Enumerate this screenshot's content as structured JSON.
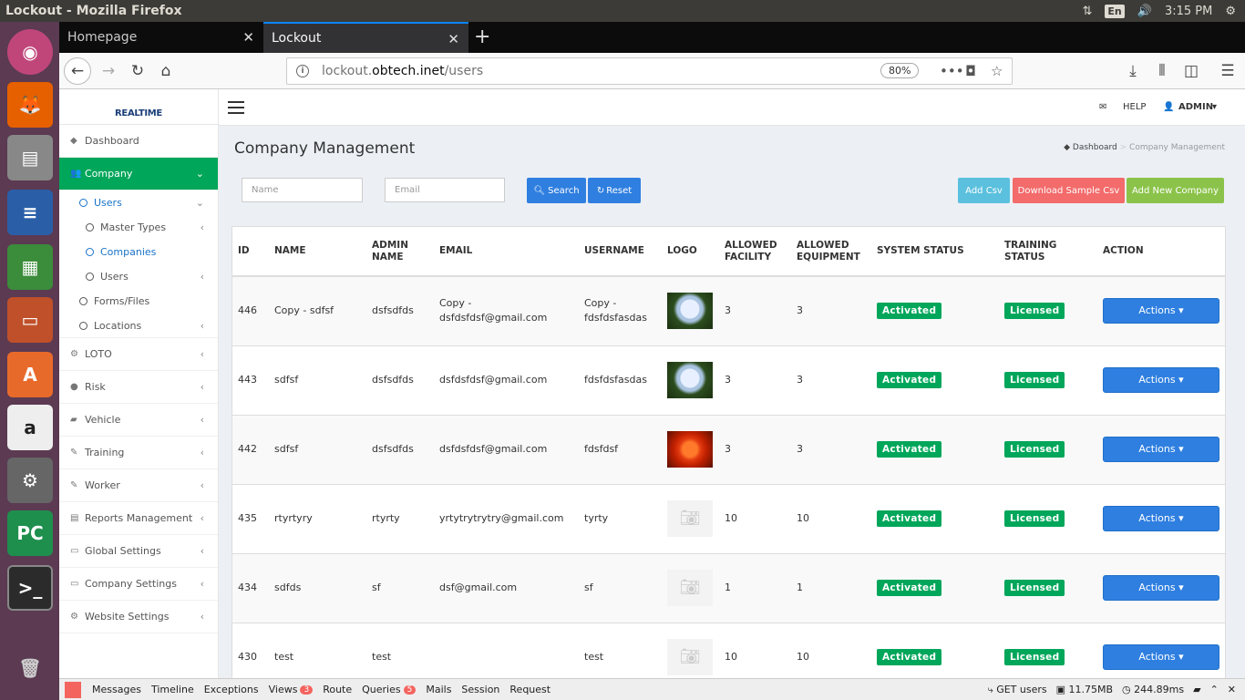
{
  "os": {
    "window_title": "Lockout - Mozilla Firefox",
    "keyboard": "En",
    "clock": "3:15 PM"
  },
  "browser": {
    "tabs": [
      {
        "label": "Homepage"
      },
      {
        "label": "Lockout"
      }
    ],
    "url_host": "lockout.",
    "url_domain": "obtech.inet",
    "url_path": "/users",
    "zoom": "80%"
  },
  "app": {
    "logo": "REALTIME",
    "header": {
      "help": "HELP",
      "user": "ADMIN"
    },
    "sidebar": [
      {
        "label": "Dashboard"
      },
      {
        "label": "Company"
      },
      {
        "label": "Users"
      },
      {
        "label": "Master Types"
      },
      {
        "label": "Companies"
      },
      {
        "label": "Users"
      },
      {
        "label": "Forms/Files"
      },
      {
        "label": "Locations"
      },
      {
        "label": "LOTO"
      },
      {
        "label": "Risk"
      },
      {
        "label": "Vehicle"
      },
      {
        "label": "Training"
      },
      {
        "label": "Worker"
      },
      {
        "label": "Reports Management"
      },
      {
        "label": "Global Settings"
      },
      {
        "label": "Company Settings"
      },
      {
        "label": "Website Settings"
      }
    ],
    "page_title": "Company Management",
    "breadcrumb": {
      "home": "Dashboard",
      "current": "Company Management"
    },
    "filters": {
      "name_placeholder": "Name",
      "email_placeholder": "Email",
      "search": "Search",
      "reset": "Reset"
    },
    "buttons": {
      "add_csv": "Add Csv",
      "download_sample": "Download Sample Csv",
      "add_company": "Add New Company"
    },
    "table": {
      "headers": [
        "ID",
        "NAME",
        "ADMIN NAME",
        "EMAIL",
        "USERNAME",
        "LOGO",
        "ALLOWED FACILITY",
        "ALLOWED EQUIPMENT",
        "SYSTEM STATUS",
        "TRAINING STATUS",
        "ACTION"
      ],
      "rows": [
        {
          "id": "446",
          "name": "Copy - sdfsf",
          "admin": "dsfsdfds",
          "email": "Copy - dsfdsfdsf@gmail.com",
          "username": "Copy - fdsfdsfasdas",
          "logo": "flower-white",
          "facility": "3",
          "equipment": "3",
          "system": "Activated",
          "training": "Licensed",
          "action": "Actions"
        },
        {
          "id": "443",
          "name": "sdfsf",
          "admin": "dsfsdfds",
          "email": "dsfdsfdsf@gmail.com",
          "username": "fdsfdsfasdas",
          "logo": "flower-white",
          "facility": "3",
          "equipment": "3",
          "system": "Activated",
          "training": "Licensed",
          "action": "Actions"
        },
        {
          "id": "442",
          "name": "sdfsf",
          "admin": "dsfsdfds",
          "email": "dsfdsfdsf@gmail.com",
          "username": "fdsfdsf",
          "logo": "flower-red",
          "facility": "3",
          "equipment": "3",
          "system": "Activated",
          "training": "Licensed",
          "action": "Actions"
        },
        {
          "id": "435",
          "name": "rtyrtyry",
          "admin": "rtyrty",
          "email": "yrtytrytrytry@gmail.com",
          "username": "tyrty",
          "logo": "camera-placeholder",
          "facility": "10",
          "equipment": "10",
          "system": "Activated",
          "training": "Licensed",
          "action": "Actions"
        },
        {
          "id": "434",
          "name": "sdfds",
          "admin": "sf",
          "email": "dsf@gmail.com",
          "username": "sf",
          "logo": "camera-placeholder",
          "facility": "1",
          "equipment": "1",
          "system": "Activated",
          "training": "Licensed",
          "action": "Actions"
        },
        {
          "id": "430",
          "name": "test",
          "admin": "test",
          "email": "",
          "username": "test",
          "logo": "camera-placeholder",
          "facility": "10",
          "equipment": "10",
          "system": "Activated",
          "training": "Licensed",
          "action": "Actions"
        }
      ]
    }
  },
  "debugbar": {
    "items": [
      {
        "label": "Messages"
      },
      {
        "label": "Timeline"
      },
      {
        "label": "Exceptions"
      },
      {
        "label": "Views",
        "count": "3"
      },
      {
        "label": "Route"
      },
      {
        "label": "Queries",
        "count": "5"
      },
      {
        "label": "Mails"
      },
      {
        "label": "Session"
      },
      {
        "label": "Request"
      }
    ],
    "method": "GET users",
    "memory": "11.75MB",
    "time": "244.89ms"
  }
}
